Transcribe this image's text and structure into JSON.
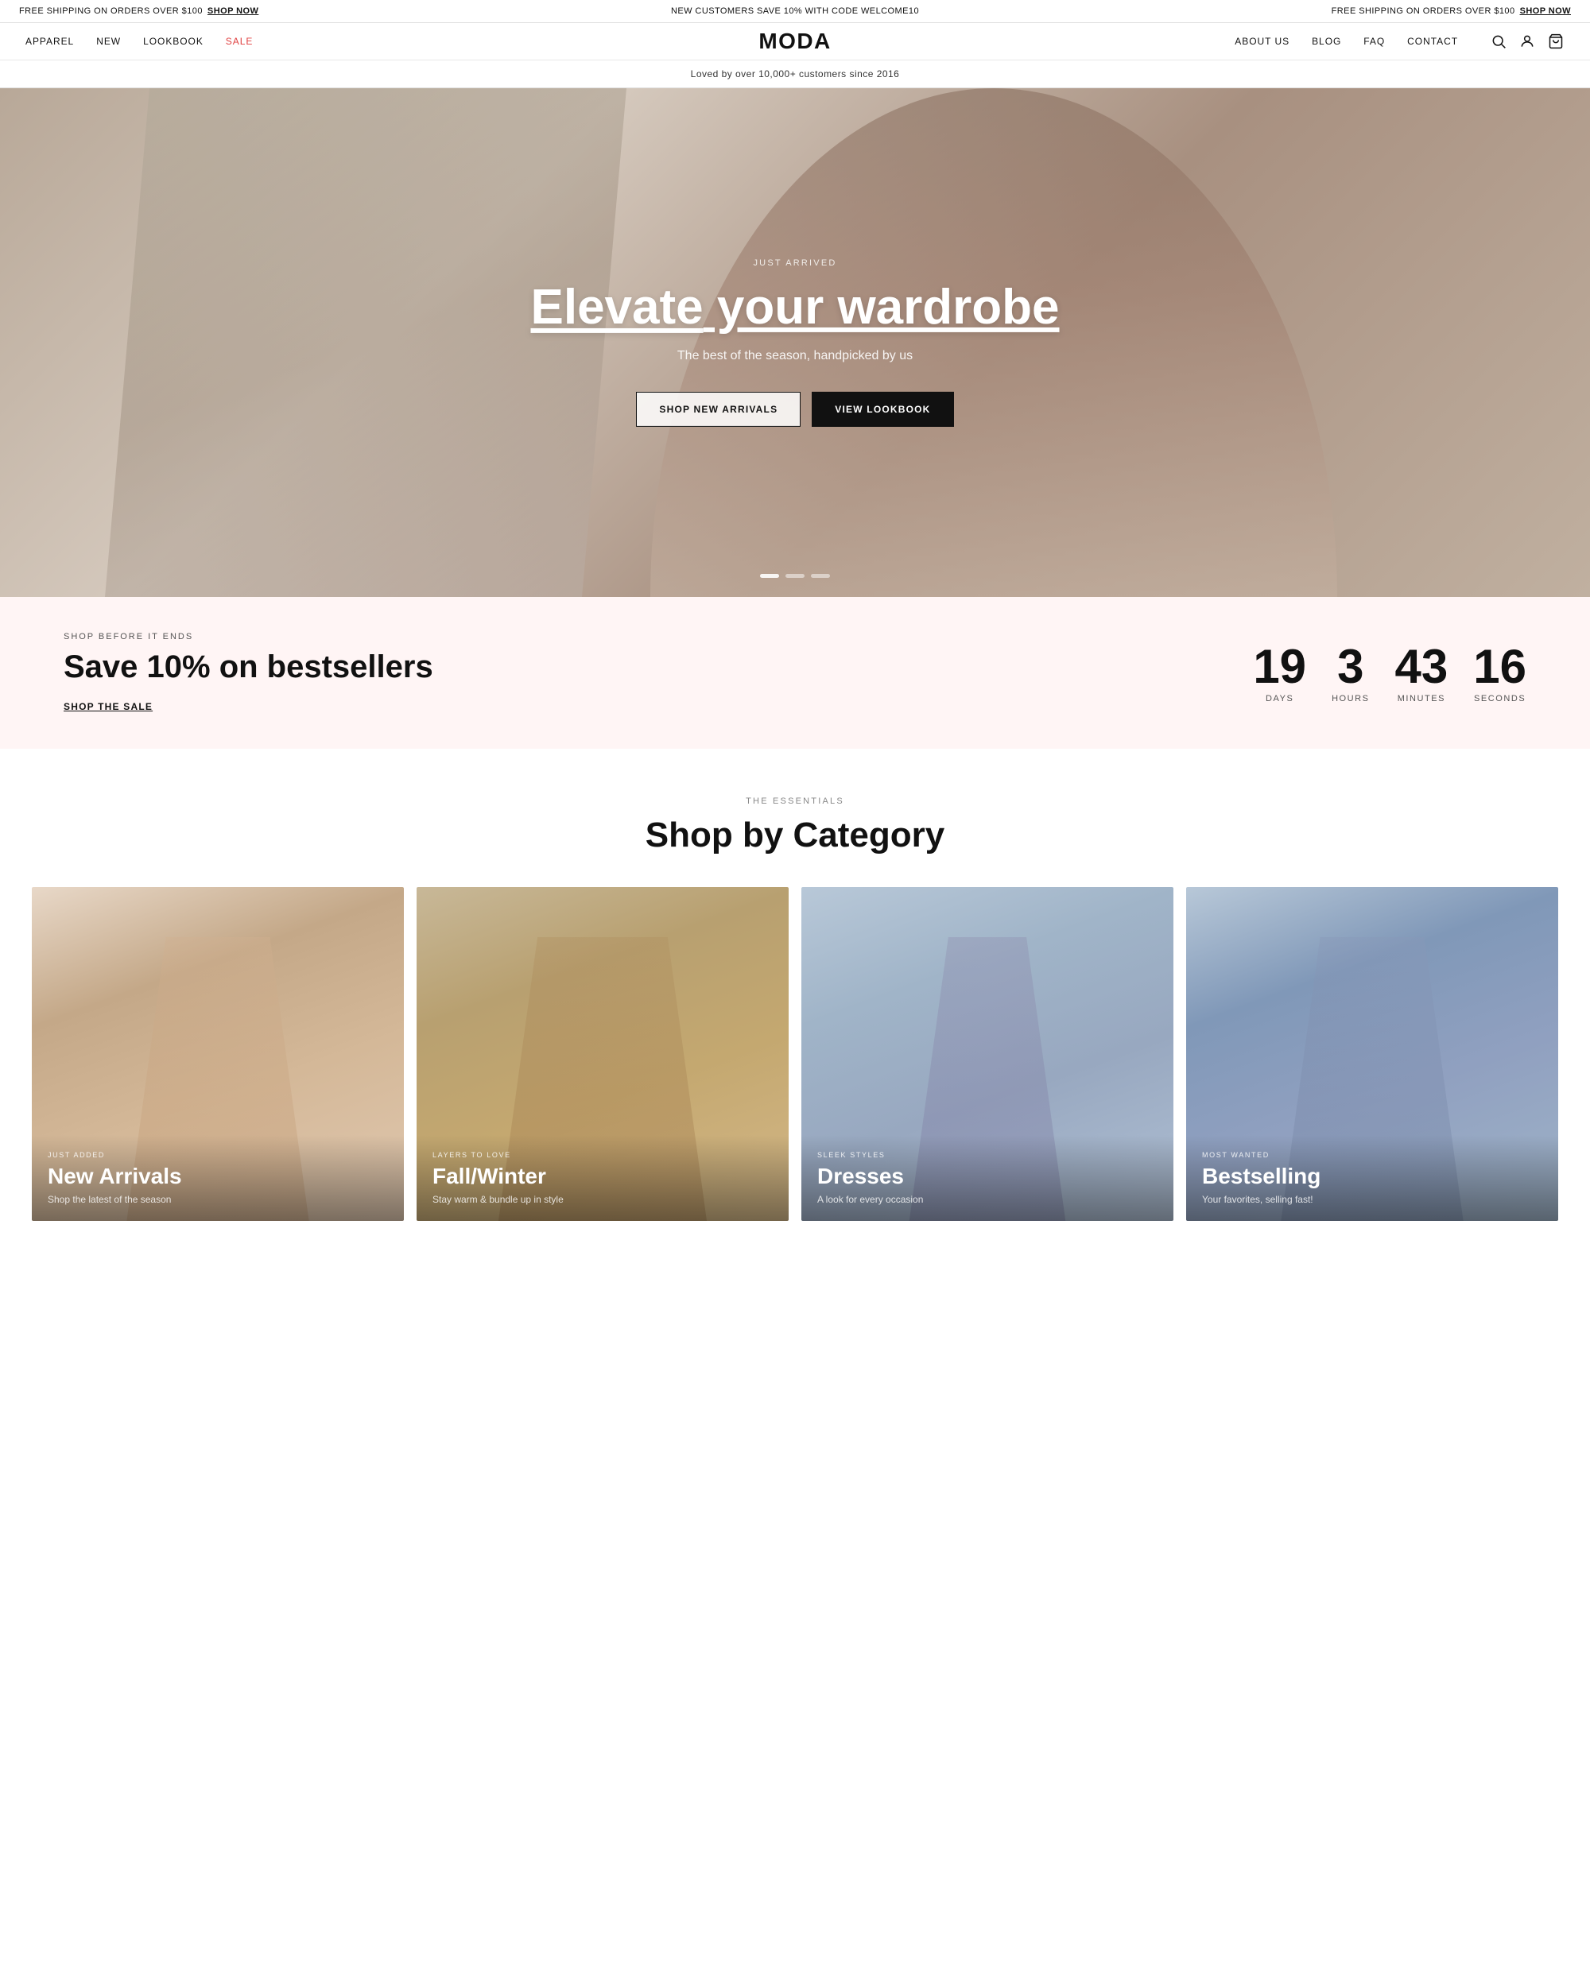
{
  "announcement": {
    "left_text": "FREE SHIPPING ON ORDERS OVER $100",
    "left_link": "SHOP NOW",
    "center_text": "NEW CUSTOMERS SAVE 10% WITH CODE WELCOME10",
    "right_text": "FREE SHIPPING ON ORDERS OVER $100",
    "right_link": "SHOP NOW"
  },
  "navbar": {
    "logo": "MODA",
    "left_links": [
      {
        "label": "APPAREL",
        "key": "apparel"
      },
      {
        "label": "NEW",
        "key": "new"
      },
      {
        "label": "LOOKBOOK",
        "key": "lookbook"
      },
      {
        "label": "SALE",
        "key": "sale",
        "highlight": true
      }
    ],
    "right_links": [
      {
        "label": "ABOUT US",
        "key": "about"
      },
      {
        "label": "BLOG",
        "key": "blog"
      },
      {
        "label": "FAQ",
        "key": "faq"
      },
      {
        "label": "CONTACT",
        "key": "contact"
      }
    ],
    "icons": [
      "search",
      "account",
      "cart"
    ]
  },
  "subbar": {
    "text": "Loved by over 10,000+ customers since 2016"
  },
  "hero": {
    "label": "JUST ARRIVED",
    "title_part1": "Elevate",
    "title_part2": " your wardrobe",
    "subtitle": "The best of the season, handpicked by us",
    "btn1": "SHOP NEW ARRIVALS",
    "btn2": "VIEW LOOKBOOK"
  },
  "sale_banner": {
    "label": "SHOP BEFORE IT ENDS",
    "title": "Save 10% on bestsellers",
    "link": "SHOP THE SALE",
    "countdown": {
      "days_num": "19",
      "days_label": "DAYS",
      "hours_num": "3",
      "hours_label": "HOURS",
      "minutes_num": "43",
      "minutes_label": "MINUTES",
      "seconds_num": "16",
      "seconds_label": "SECONDS"
    }
  },
  "categories": {
    "section_label": "THE ESSENTIALS",
    "section_title": "Shop by Category",
    "items": [
      {
        "tag": "JUST ADDED",
        "title": "New Arrivals",
        "subtitle": "Shop the latest of the season"
      },
      {
        "tag": "LAYERS TO LOVE",
        "title": "Fall/Winter",
        "subtitle": "Stay warm & bundle up in style"
      },
      {
        "tag": "SLEEK STYLES",
        "title": "Dresses",
        "subtitle": "A look for every occasion"
      },
      {
        "tag": "MOST WANTED",
        "title": "Bestselling",
        "subtitle": "Your favorites, selling fast!"
      }
    ]
  }
}
